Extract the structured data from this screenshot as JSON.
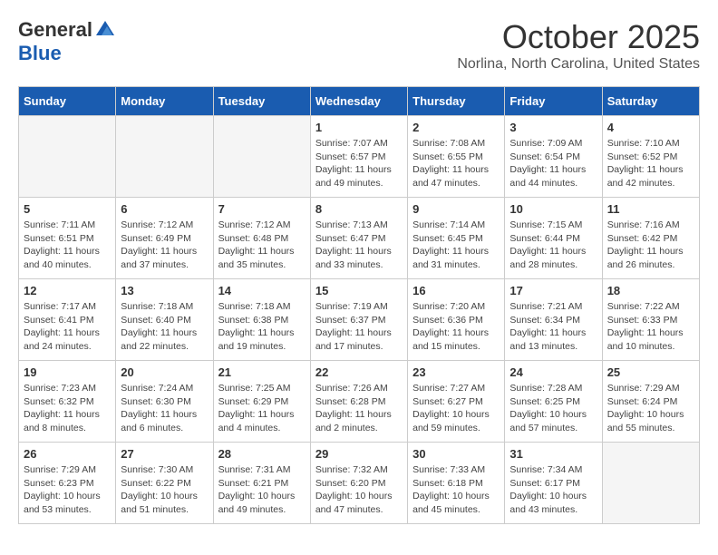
{
  "header": {
    "logo": {
      "general": "General",
      "blue": "Blue"
    },
    "month_title": "October 2025",
    "location": "Norlina, North Carolina, United States"
  },
  "days_of_week": [
    "Sunday",
    "Monday",
    "Tuesday",
    "Wednesday",
    "Thursday",
    "Friday",
    "Saturday"
  ],
  "weeks": [
    [
      {
        "day": "",
        "info": ""
      },
      {
        "day": "",
        "info": ""
      },
      {
        "day": "",
        "info": ""
      },
      {
        "day": "1",
        "info": "Sunrise: 7:07 AM\nSunset: 6:57 PM\nDaylight: 11 hours and 49 minutes."
      },
      {
        "day": "2",
        "info": "Sunrise: 7:08 AM\nSunset: 6:55 PM\nDaylight: 11 hours and 47 minutes."
      },
      {
        "day": "3",
        "info": "Sunrise: 7:09 AM\nSunset: 6:54 PM\nDaylight: 11 hours and 44 minutes."
      },
      {
        "day": "4",
        "info": "Sunrise: 7:10 AM\nSunset: 6:52 PM\nDaylight: 11 hours and 42 minutes."
      }
    ],
    [
      {
        "day": "5",
        "info": "Sunrise: 7:11 AM\nSunset: 6:51 PM\nDaylight: 11 hours and 40 minutes."
      },
      {
        "day": "6",
        "info": "Sunrise: 7:12 AM\nSunset: 6:49 PM\nDaylight: 11 hours and 37 minutes."
      },
      {
        "day": "7",
        "info": "Sunrise: 7:12 AM\nSunset: 6:48 PM\nDaylight: 11 hours and 35 minutes."
      },
      {
        "day": "8",
        "info": "Sunrise: 7:13 AM\nSunset: 6:47 PM\nDaylight: 11 hours and 33 minutes."
      },
      {
        "day": "9",
        "info": "Sunrise: 7:14 AM\nSunset: 6:45 PM\nDaylight: 11 hours and 31 minutes."
      },
      {
        "day": "10",
        "info": "Sunrise: 7:15 AM\nSunset: 6:44 PM\nDaylight: 11 hours and 28 minutes."
      },
      {
        "day": "11",
        "info": "Sunrise: 7:16 AM\nSunset: 6:42 PM\nDaylight: 11 hours and 26 minutes."
      }
    ],
    [
      {
        "day": "12",
        "info": "Sunrise: 7:17 AM\nSunset: 6:41 PM\nDaylight: 11 hours and 24 minutes."
      },
      {
        "day": "13",
        "info": "Sunrise: 7:18 AM\nSunset: 6:40 PM\nDaylight: 11 hours and 22 minutes."
      },
      {
        "day": "14",
        "info": "Sunrise: 7:18 AM\nSunset: 6:38 PM\nDaylight: 11 hours and 19 minutes."
      },
      {
        "day": "15",
        "info": "Sunrise: 7:19 AM\nSunset: 6:37 PM\nDaylight: 11 hours and 17 minutes."
      },
      {
        "day": "16",
        "info": "Sunrise: 7:20 AM\nSunset: 6:36 PM\nDaylight: 11 hours and 15 minutes."
      },
      {
        "day": "17",
        "info": "Sunrise: 7:21 AM\nSunset: 6:34 PM\nDaylight: 11 hours and 13 minutes."
      },
      {
        "day": "18",
        "info": "Sunrise: 7:22 AM\nSunset: 6:33 PM\nDaylight: 11 hours and 10 minutes."
      }
    ],
    [
      {
        "day": "19",
        "info": "Sunrise: 7:23 AM\nSunset: 6:32 PM\nDaylight: 11 hours and 8 minutes."
      },
      {
        "day": "20",
        "info": "Sunrise: 7:24 AM\nSunset: 6:30 PM\nDaylight: 11 hours and 6 minutes."
      },
      {
        "day": "21",
        "info": "Sunrise: 7:25 AM\nSunset: 6:29 PM\nDaylight: 11 hours and 4 minutes."
      },
      {
        "day": "22",
        "info": "Sunrise: 7:26 AM\nSunset: 6:28 PM\nDaylight: 11 hours and 2 minutes."
      },
      {
        "day": "23",
        "info": "Sunrise: 7:27 AM\nSunset: 6:27 PM\nDaylight: 10 hours and 59 minutes."
      },
      {
        "day": "24",
        "info": "Sunrise: 7:28 AM\nSunset: 6:25 PM\nDaylight: 10 hours and 57 minutes."
      },
      {
        "day": "25",
        "info": "Sunrise: 7:29 AM\nSunset: 6:24 PM\nDaylight: 10 hours and 55 minutes."
      }
    ],
    [
      {
        "day": "26",
        "info": "Sunrise: 7:29 AM\nSunset: 6:23 PM\nDaylight: 10 hours and 53 minutes."
      },
      {
        "day": "27",
        "info": "Sunrise: 7:30 AM\nSunset: 6:22 PM\nDaylight: 10 hours and 51 minutes."
      },
      {
        "day": "28",
        "info": "Sunrise: 7:31 AM\nSunset: 6:21 PM\nDaylight: 10 hours and 49 minutes."
      },
      {
        "day": "29",
        "info": "Sunrise: 7:32 AM\nSunset: 6:20 PM\nDaylight: 10 hours and 47 minutes."
      },
      {
        "day": "30",
        "info": "Sunrise: 7:33 AM\nSunset: 6:18 PM\nDaylight: 10 hours and 45 minutes."
      },
      {
        "day": "31",
        "info": "Sunrise: 7:34 AM\nSunset: 6:17 PM\nDaylight: 10 hours and 43 minutes."
      },
      {
        "day": "",
        "info": ""
      }
    ]
  ]
}
